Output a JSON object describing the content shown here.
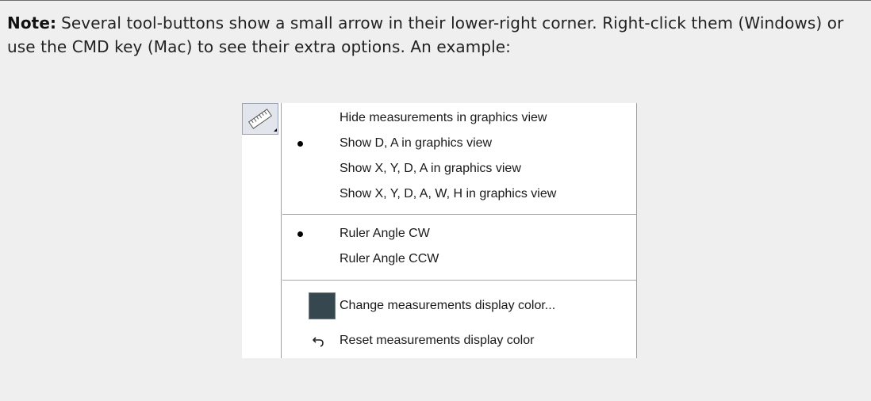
{
  "note": {
    "label": "Note:",
    "text": "Several tool-buttons show a small arrow in their lower-right corner. Right-click them (Windows) or use the CMD key (Mac) to see their extra options. An example:"
  },
  "toolbar": {
    "tool_icon": "ruler-icon",
    "has_options_arrow": true
  },
  "menu": {
    "group_display": [
      {
        "label": "Hide measurements in graphics view",
        "selected": false
      },
      {
        "label": "Show D, A in graphics view",
        "selected": true
      },
      {
        "label": "Show X, Y, D, A in graphics view",
        "selected": false
      },
      {
        "label": "Show X, Y, D, A, W, H in graphics view",
        "selected": false
      }
    ],
    "group_angle": [
      {
        "label": "Ruler Angle CW",
        "selected": true
      },
      {
        "label": "Ruler Angle CCW",
        "selected": false
      }
    ],
    "change_color": {
      "label": "Change measurements display color...",
      "swatch_color": "#37474f"
    },
    "reset_color": {
      "label": "Reset measurements display color",
      "icon": "undo-arrow-icon"
    }
  }
}
